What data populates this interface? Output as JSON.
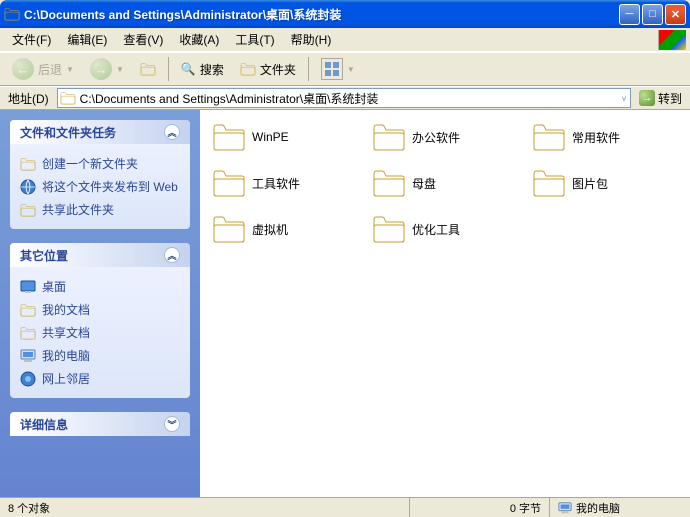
{
  "window": {
    "title": "C:\\Documents and Settings\\Administrator\\桌面\\系统封装"
  },
  "menu": {
    "file": "文件(F)",
    "edit": "编辑(E)",
    "view": "查看(V)",
    "favorites": "收藏(A)",
    "tools": "工具(T)",
    "help": "帮助(H)"
  },
  "toolbar": {
    "back": "后退",
    "search": "搜索",
    "folders": "文件夹"
  },
  "address": {
    "label": "地址(D)",
    "path": "C:\\Documents and Settings\\Administrator\\桌面\\系统封装",
    "go": "转到"
  },
  "tasks": {
    "title": "文件和文件夹任务",
    "items": [
      "创建一个新文件夹",
      "将这个文件夹发布到 Web",
      "共享此文件夹"
    ]
  },
  "places": {
    "title": "其它位置",
    "items": [
      "桌面",
      "我的文档",
      "共享文档",
      "我的电脑",
      "网上邻居"
    ]
  },
  "details": {
    "title": "详细信息"
  },
  "folders": [
    "WinPE",
    "办公软件",
    "常用软件",
    "工具软件",
    "母盘",
    "图片包",
    "虚拟机",
    "优化工具"
  ],
  "status": {
    "count": "8 个对象",
    "size": "0 字节",
    "location": "我的电脑"
  }
}
